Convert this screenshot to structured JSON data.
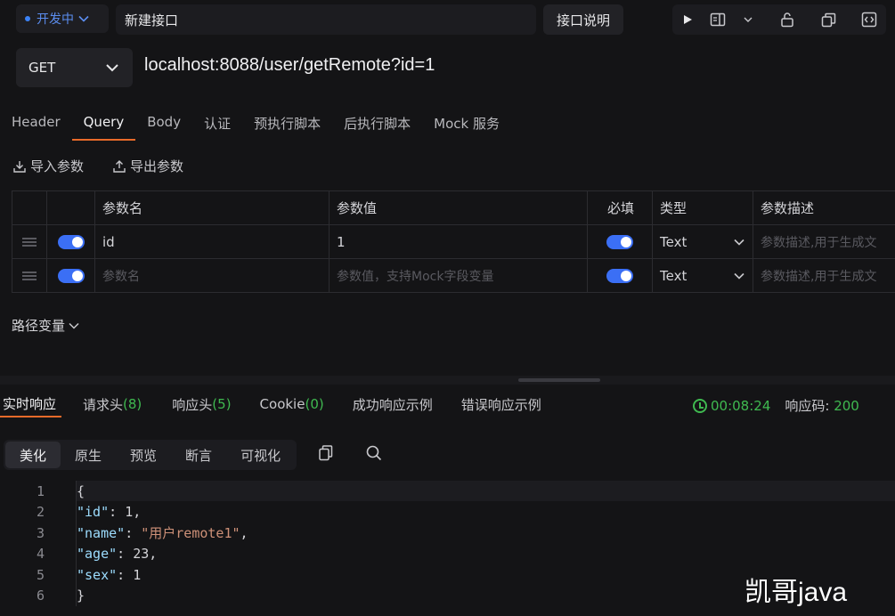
{
  "topbar": {
    "status_label": "开发中",
    "api_name": "新建接口",
    "doc_button": "接口说明"
  },
  "request": {
    "method": "GET",
    "url": "localhost:8088/user/getRemote?id=1"
  },
  "tabs": [
    {
      "label": "Header"
    },
    {
      "label": "Query",
      "active": true
    },
    {
      "label": "Body"
    },
    {
      "label": "认证"
    },
    {
      "label": "预执行脚本"
    },
    {
      "label": "后执行脚本"
    },
    {
      "label": "Mock 服务"
    }
  ],
  "actions": {
    "import": "导入参数",
    "export": "导出参数"
  },
  "params": {
    "headers": [
      "参数名",
      "参数值",
      "必填",
      "类型",
      "参数描述"
    ],
    "rows": [
      {
        "name": "id",
        "value": "1",
        "type": "Text",
        "desc_placeholder": "参数描述,用于生成文"
      },
      {
        "name_placeholder": "参数名",
        "value_placeholder": "参数值，支持Mock字段变量",
        "type": "Text",
        "desc_placeholder": "参数描述,用于生成文"
      }
    ]
  },
  "path_vars_label": "路径变量",
  "response": {
    "tabs": [
      {
        "label": "实时响应",
        "active": true
      },
      {
        "label": "请求头",
        "count": "(8)"
      },
      {
        "label": "响应头",
        "count": "(5)"
      },
      {
        "label": "Cookie",
        "count": "(0)"
      },
      {
        "label": "成功响应示例"
      },
      {
        "label": "错误响应示例"
      }
    ],
    "time": "00:08:24",
    "status_label": "响应码:",
    "status_code": "200",
    "modes": [
      "美化",
      "原生",
      "预览",
      "断言",
      "可视化"
    ],
    "code_lines": [
      {
        "n": "1",
        "text": "{"
      },
      {
        "n": "2",
        "key": "\"id\"",
        "val": "1",
        "val_type": "num",
        "comma": ","
      },
      {
        "n": "3",
        "key": "\"name\"",
        "val": "\"用户remote1\"",
        "val_type": "str",
        "comma": ","
      },
      {
        "n": "4",
        "key": "\"age\"",
        "val": "23",
        "val_type": "num",
        "comma": ","
      },
      {
        "n": "5",
        "key": "\"sex\"",
        "val": "1",
        "val_type": "num",
        "comma": ""
      },
      {
        "n": "6",
        "text": "}"
      }
    ]
  },
  "watermark": "凯哥java",
  "colors": {
    "accent": "#e86a2a",
    "toggle": "#3b6ff5",
    "success": "#3fb950",
    "dev_status": "#3b82f6"
  }
}
